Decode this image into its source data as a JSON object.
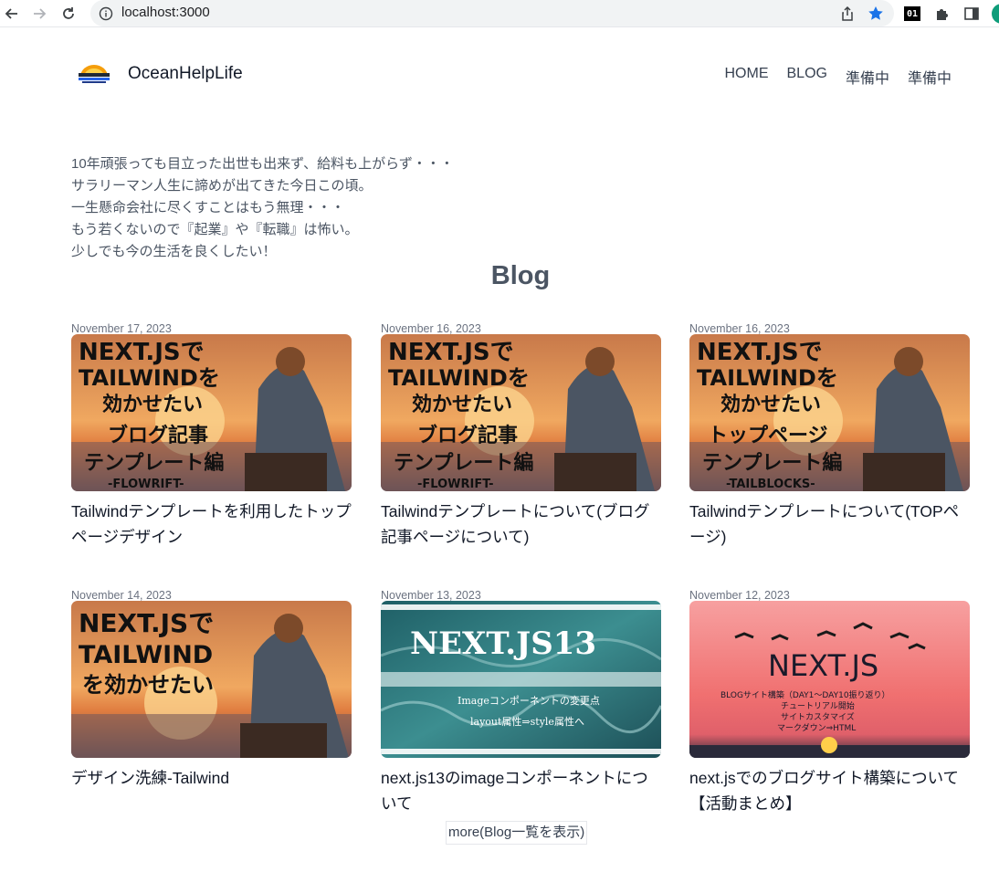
{
  "browser": {
    "url": "localhost:3000",
    "extension_label": "01"
  },
  "site": {
    "brand": "OceanHelpLife",
    "nav": [
      "HOME",
      "BLOG",
      "準備中",
      "準備中"
    ]
  },
  "intro": {
    "lines": [
      "10年頑張っても目立った出世も出来ず、給料も上がらず・・・",
      "サラリーマン人生に諦めが出てきた今日この頃。",
      "一生懸命会社に尽くすことはもう無理・・・",
      "もう若くないので『起業』や『転職』は怖い。",
      "少しでも今の生活を良くしたい！"
    ]
  },
  "blog": {
    "heading": "Blog",
    "posts": [
      {
        "date": "November 17, 2023",
        "title": "Tailwindテンプレートを利用したトップページデザイン",
        "image_text": [
          "NEXT.JSで",
          "TAILWINDを",
          "効かせたい",
          "ブログ記事",
          "テンプレート編",
          "-FLOWRIFT-"
        ]
      },
      {
        "date": "November 16, 2023",
        "title": "Tailwindテンプレートについて(ブログ記事ページについて)",
        "image_text": [
          "NEXT.JSで",
          "TAILWINDを",
          "効かせたい",
          "ブログ記事",
          "テンプレート編",
          "-FLOWRIFT-"
        ]
      },
      {
        "date": "November 16, 2023",
        "title": "Tailwindテンプレートについて(TOPページ)",
        "image_text": [
          "NEXT.JSで",
          "TAILWINDを",
          "効かせたい",
          "トップページ",
          "テンプレート編",
          "-TAILBLOCKS-"
        ]
      },
      {
        "date": "November 14, 2023",
        "title": "デザイン洗練-Tailwind",
        "image_text": [
          "NEXT.JSで",
          "TAILWIND",
          "を効かせたい"
        ]
      },
      {
        "date": "November 13, 2023",
        "title": "next.js13のimageコンポーネントについて",
        "image_text": [
          "NEXT.JS13",
          "Imageコンポーネントの変更点",
          "layout属性⇒style属性へ"
        ]
      },
      {
        "date": "November 12, 2023",
        "title": "next.jsでのブログサイト構築について【活動まとめ】",
        "image_text": [
          "NEXT.JS",
          "BLOGサイト構築（DAY1～DAY10振り返り）",
          "チュートリアル開始",
          "サイトカスタマイズ",
          "マークダウン⇒HTML"
        ]
      }
    ],
    "more_label": "more(Blog一覧を表示)"
  },
  "colors": {
    "sunset_sky": "#e98a4f",
    "ocean_teal": "#2e7d80",
    "pink_sky": "#f0787a"
  },
  "icons": [
    "back-icon",
    "forward-icon",
    "reload-icon",
    "info-icon",
    "share-icon",
    "star-icon",
    "puzzle-icon",
    "sidepanel-icon",
    "profile-icon"
  ]
}
